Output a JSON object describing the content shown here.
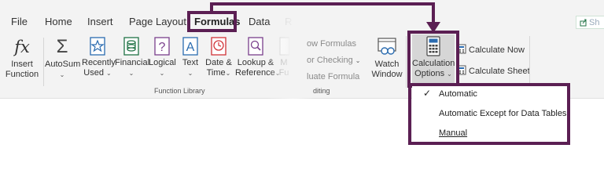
{
  "tabs": [
    "File",
    "Home",
    "Insert",
    "Page Layout",
    "Formulas",
    "Data",
    "R"
  ],
  "active_tab": "Formulas",
  "share_fragment": "Sh",
  "function_library": {
    "group_label": "Function Library",
    "insert_function": [
      "Insert",
      "Function"
    ],
    "autosum": "AutoSum",
    "recently_used": [
      "Recently",
      "Used"
    ],
    "financial": "Financial",
    "logical": "Logical",
    "text": "Text",
    "date_time": [
      "Date &",
      "Time"
    ],
    "lookup_reference": [
      "Lookup &",
      "Reference"
    ],
    "more_fragment": [
      "M",
      "Fu"
    ]
  },
  "formula_auditing": {
    "group_label_fragment": "diting",
    "show_formulas": "ow Formulas",
    "error_checking": "or Checking",
    "evaluate_formula": "luate Formula",
    "watch_window": [
      "Watch",
      "Window"
    ]
  },
  "calculation": {
    "options": [
      "Calculation",
      "Options"
    ],
    "calculate_now": "Calculate Now",
    "calculate_sheet": "Calculate Sheet"
  },
  "calculation_menu": {
    "items": [
      "Automatic",
      "Automatic Except for Data Tables",
      "Manual"
    ],
    "checked": "Automatic"
  },
  "accent": "#5b1f53",
  "icon_colors": {
    "green": "#217346",
    "purple": "#7a3f8c",
    "red": "#d13438",
    "blue": "#2b6cb0"
  }
}
